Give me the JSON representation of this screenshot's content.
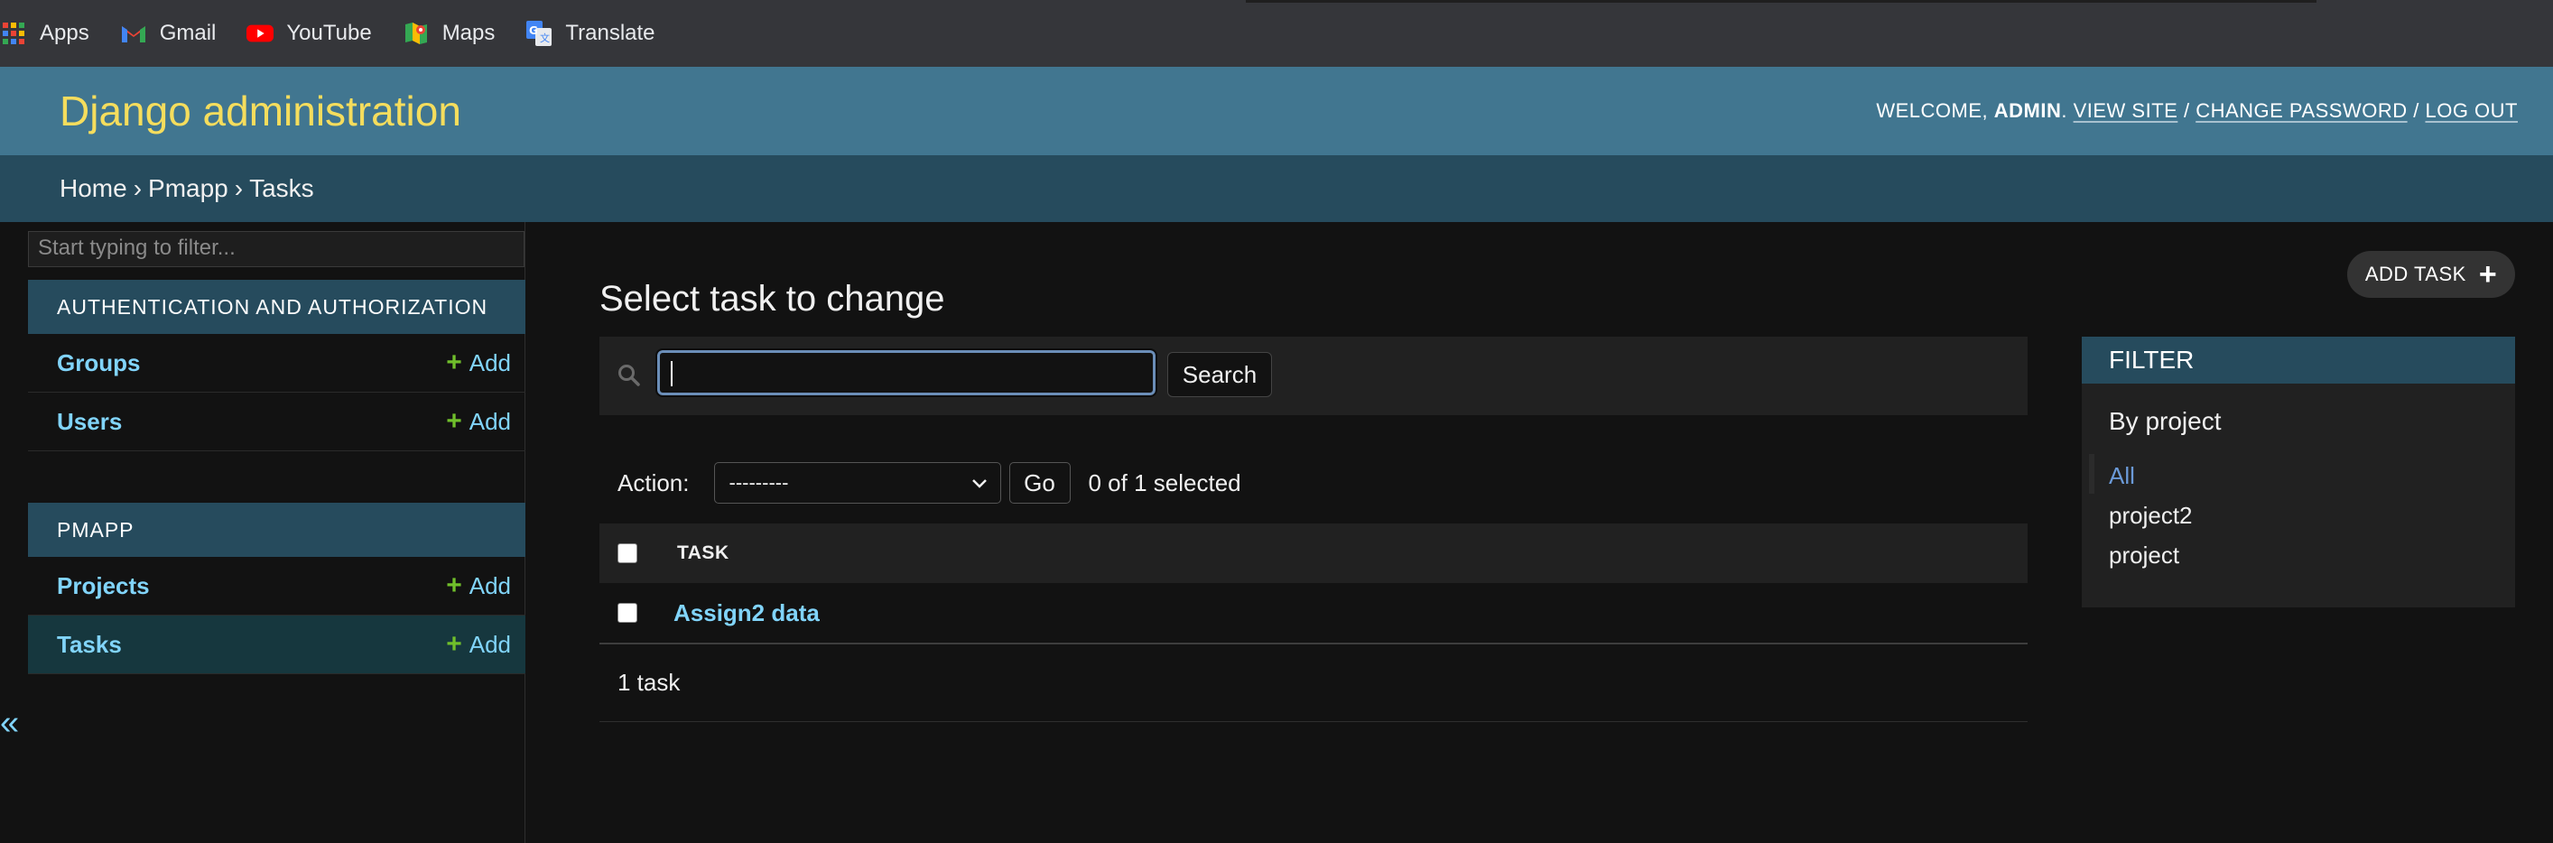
{
  "bookmarks": [
    {
      "label": "Apps",
      "icon": "apps-grid-icon"
    },
    {
      "label": "Gmail",
      "icon": "gmail-icon"
    },
    {
      "label": "YouTube",
      "icon": "youtube-icon"
    },
    {
      "label": "Maps",
      "icon": "maps-icon"
    },
    {
      "label": "Translate",
      "icon": "translate-icon"
    }
  ],
  "header": {
    "branding": "Django administration",
    "welcome": "WELCOME, ",
    "user": "ADMIN",
    "period": ".",
    "view_site": "VIEW SITE",
    "sep": " / ",
    "change_password": "CHANGE PASSWORD",
    "log_out": "LOG OUT"
  },
  "breadcrumbs": {
    "home": "Home",
    "app": "Pmapp",
    "current": "Tasks",
    "separator": "›"
  },
  "sidebar": {
    "filter_placeholder": "Start typing to filter...",
    "collapse": "«",
    "add_label": "Add",
    "modules": [
      {
        "caption": "AUTHENTICATION AND AUTHORIZATION",
        "models": [
          "Groups",
          "Users"
        ]
      },
      {
        "caption": "PMAPP",
        "models": [
          "Projects",
          "Tasks"
        ],
        "active": "Tasks"
      }
    ]
  },
  "content": {
    "title": "Select task to change",
    "add_button": "ADD TASK",
    "search_button": "Search",
    "search_value": "",
    "action_label": "Action:",
    "action_selected": "---------",
    "go_button": "Go",
    "selection_count": "0 of 1 selected",
    "table": {
      "columns": [
        "TASK"
      ],
      "rows": [
        "Assign2 data"
      ]
    },
    "paginator": "1 task"
  },
  "filter": {
    "title": "FILTER",
    "by": "By project",
    "options": [
      "All",
      "project2",
      "project"
    ],
    "selected": "All"
  },
  "colors": {
    "header_bg": "#417690",
    "branding": "#f5dd5d",
    "breadcrumb_bg": "#264b5d",
    "link": "#81d4fa",
    "add_plus": "#70bf2b",
    "page_bg": "#121212"
  }
}
